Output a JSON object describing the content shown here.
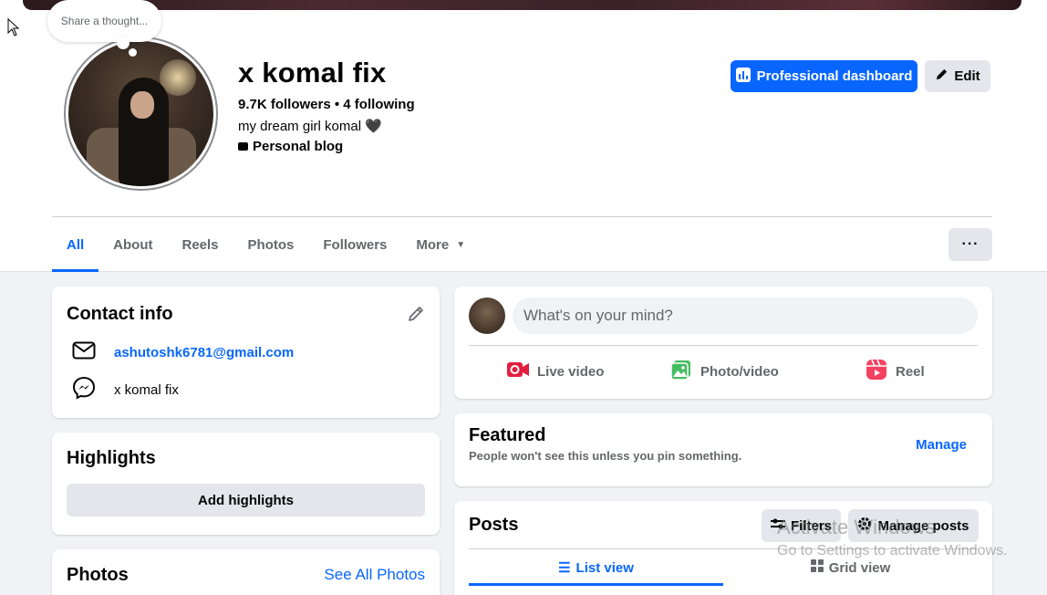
{
  "thought_bubble": {
    "text": "Share a thought..."
  },
  "profile": {
    "name": "x komal fix",
    "stats": "9.7K followers • 4 following",
    "bio": "my dream girl komal 🖤",
    "category": "Personal blog"
  },
  "header_buttons": {
    "professional_dashboard": "Professional dashboard",
    "edit": "Edit",
    "more": "···"
  },
  "tabs": [
    {
      "label": "All",
      "active": true
    },
    {
      "label": "About",
      "active": false
    },
    {
      "label": "Reels",
      "active": false
    },
    {
      "label": "Photos",
      "active": false
    },
    {
      "label": "Followers",
      "active": false
    },
    {
      "label": "More",
      "active": false
    }
  ],
  "contact_info": {
    "title": "Contact info",
    "email": "ashutoshk6781@gmail.com",
    "messenger": "x komal fix"
  },
  "highlights": {
    "title": "Highlights",
    "button": "Add highlights"
  },
  "photos": {
    "title": "Photos",
    "see_all": "See All Photos"
  },
  "composer": {
    "placeholder": "What's on your mind?",
    "actions": {
      "live": "Live video",
      "photo": "Photo/video",
      "reel": "Reel"
    }
  },
  "featured": {
    "title": "Featured",
    "subtitle": "People won't see this unless you pin something.",
    "manage": "Manage"
  },
  "posts": {
    "title": "Posts",
    "filters": "Filters",
    "manage_posts": "Manage posts",
    "list_view": "List view",
    "grid_view": "Grid view"
  },
  "watermark": {
    "line1": "Activate Windows",
    "line2": "Go to Settings to activate Windows."
  },
  "colors": {
    "accent": "#0866ff",
    "background": "#f0f2f5",
    "secondary_button": "#e4e6eb",
    "muted_text": "#65676b",
    "live_icon": "#e41e3f",
    "photo_icon": "#45bd62",
    "reel_icon": "#f3425f"
  }
}
